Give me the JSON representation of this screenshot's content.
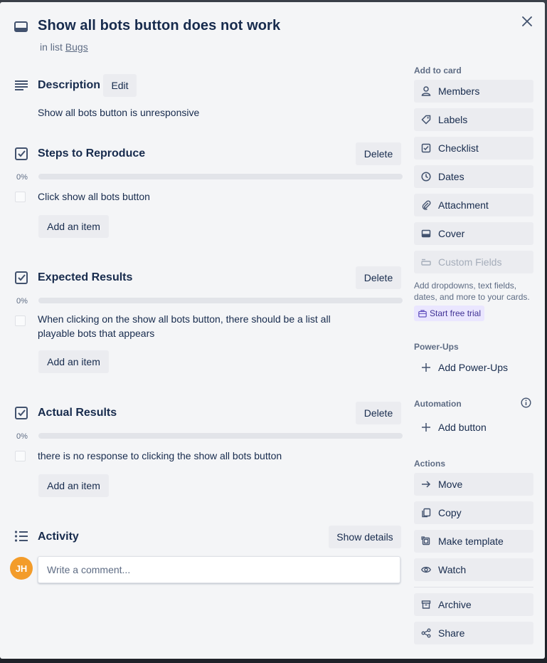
{
  "card": {
    "title": "Show all bots button does not work",
    "in_list_prefix": "in list",
    "list_name": "Bugs"
  },
  "description": {
    "title": "Description",
    "edit_label": "Edit",
    "text": "Show all bots button is unresponsive"
  },
  "checklists": [
    {
      "title": "Steps to Reproduce",
      "delete_label": "Delete",
      "percent": "0%",
      "progress": 0,
      "items": [
        "Click show all bots button"
      ],
      "add_item_label": "Add an item"
    },
    {
      "title": "Expected Results",
      "delete_label": "Delete",
      "percent": "0%",
      "progress": 0,
      "items": [
        "When clicking on the show all bots button, there should be a list all playable bots that appears"
      ],
      "add_item_label": "Add an item"
    },
    {
      "title": "Actual Results",
      "delete_label": "Delete",
      "percent": "0%",
      "progress": 0,
      "items": [
        "there is no response to clicking the show all bots button"
      ],
      "add_item_label": "Add an item"
    }
  ],
  "activity": {
    "title": "Activity",
    "show_details_label": "Show details",
    "avatar_initials": "JH",
    "comment_placeholder": "Write a comment..."
  },
  "sidebar": {
    "add_to_card_label": "Add to card",
    "add_to_card": [
      {
        "label": "Members",
        "icon": "person-icon"
      },
      {
        "label": "Labels",
        "icon": "tag-icon"
      },
      {
        "label": "Checklist",
        "icon": "checklist-icon"
      },
      {
        "label": "Dates",
        "icon": "clock-icon"
      },
      {
        "label": "Attachment",
        "icon": "paperclip-icon"
      },
      {
        "label": "Cover",
        "icon": "cover-icon"
      },
      {
        "label": "Custom Fields",
        "icon": "custom-fields-icon"
      }
    ],
    "custom_fields_note": "Add dropdowns, text fields, dates, and more to your cards.",
    "trial_label": "Start free trial",
    "powerups_label": "Power-Ups",
    "add_powerups_label": "Add Power-Ups",
    "automation_label": "Automation",
    "add_button_label": "Add button",
    "actions_label": "Actions",
    "actions": [
      {
        "label": "Move",
        "icon": "arrow-right-icon"
      },
      {
        "label": "Copy",
        "icon": "copy-icon"
      },
      {
        "label": "Make template",
        "icon": "template-icon"
      },
      {
        "label": "Watch",
        "icon": "eye-icon"
      },
      {
        "label": "Archive",
        "icon": "archive-icon"
      },
      {
        "label": "Share",
        "icon": "share-icon"
      }
    ]
  },
  "colors": {
    "modal_bg": "#f4f5f7",
    "button_bg": "#ebecf0",
    "text": "#172b4d",
    "muted": "#5e6c84",
    "avatar": "#f39c2a",
    "trial_bg": "#eae6ff"
  }
}
